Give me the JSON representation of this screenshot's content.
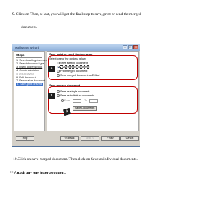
{
  "doc": {
    "step9_line1": "9.  Click on Then, at last, you will get the final step to save, print or send the merged",
    "step9_line2": "document.",
    "step10": "10.Click on save merged document. Then click on Save as individual documents.",
    "note": "** Attach any one letter as output."
  },
  "dialog": {
    "title": "Mail Merge Wizard",
    "steps_heading": "Steps",
    "steps": [
      {
        "label": "1. Select starting document",
        "state": "normal"
      },
      {
        "label": "2. Select document type",
        "state": "normal"
      },
      {
        "label": "3. Insert address block",
        "state": "link"
      },
      {
        "label": "4. Create salutation",
        "state": "normal"
      },
      {
        "label": "5. Adjust layout",
        "state": "disabled"
      },
      {
        "label": "6. Edit document",
        "state": "normal"
      },
      {
        "label": "7. Personalize document",
        "state": "normal"
      },
      {
        "label": "8. Save, print or send",
        "state": "selected"
      }
    ],
    "section1_heading": "Save, print or send the document",
    "section1_prompt": "Select one of the options below:",
    "options1": [
      {
        "label": "Save starting document",
        "selected": false
      },
      {
        "label": "Save merged document",
        "selected": true
      },
      {
        "label": "Print merged document",
        "selected": false
      },
      {
        "label": "Send merged document as E-Mail",
        "selected": false
      }
    ],
    "section2_heading": "Save merged document",
    "options2": [
      {
        "label": "Save as single document",
        "selected": false
      },
      {
        "label": "Save as individual documents",
        "selected": true
      }
    ],
    "from_label": "From",
    "to_label": "To",
    "save_documents_button": "Save Documents",
    "callouts": [
      "1",
      "2",
      "3"
    ],
    "buttons": {
      "help": "Help",
      "back": "<< Back",
      "next": "Next >>",
      "finish": "Finish",
      "cancel": "Cancel"
    }
  }
}
